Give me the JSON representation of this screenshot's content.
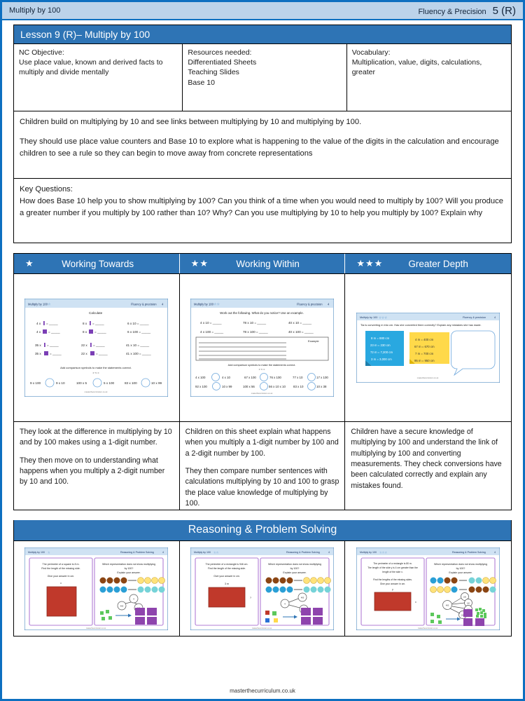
{
  "header": {
    "left_title": "Multiply by 100",
    "right_label": "Fluency & Precision",
    "page_number": "5 (R)"
  },
  "lesson": {
    "title": "Lesson 9 (R)– Multiply by 100",
    "nc_objective_label": "NC Objective:",
    "nc_objective_text": "Use place value, known and derived facts to multiply and divide mentally",
    "resources_label": "Resources needed:",
    "resources_items": [
      "Differentiated Sheets",
      "Teaching Slides",
      "Base 10"
    ],
    "vocabulary_label": "Vocabulary:",
    "vocabulary_text": "Multiplication, value, digits, calculations, greater"
  },
  "overview": {
    "para1": "Children build on multiplying by 10 and see links between multiplying by 10 and multiplying by 100.",
    "para2": "They should use place value counters and Base 10 to explore what is happening to the value of the digits in   the calculation and encourage children to see a rule so they can begin to move away from concrete representations"
  },
  "key_questions": {
    "label": "Key Questions:",
    "text": "How does Base 10 help you to show multiplying by 100? Can you think of a time when you would need to  multiply by 100? Will you produce a greater number if you multiply by 100 rather than 10? Why? Can you  use multiplying by 10 to help you multiply by 100? Explain why"
  },
  "differentiation": {
    "columns": [
      {
        "stars": "★",
        "label": "Working Towards",
        "description_1": "They look at the difference in multiplying by 10 and by 100 makes using a 1-digit number.",
        "description_2": "They then move on to understanding what happens when you  multiply a 2-digit number by 10 and 100."
      },
      {
        "stars": "★★",
        "label": "Working Within",
        "description_1": "Children on this sheet explain what happens when you multiply a 1-digit number by 100 and a 2-digit number by 100.",
        "description_2": "They then compare number sentences with calculations multiplying by 10 and 100 to grasp the place value knowledge of multiplying by 100."
      },
      {
        "stars": "★★★",
        "label": "Greater Depth",
        "description_1": "Children have a secure knowledge of multiplying by 100 and understand the link of multiplying by 100 and converting measurements. They check conversions have been calculated correctly and explain any mistakes found.",
        "description_2": ""
      }
    ]
  },
  "worksheet_previews": {
    "sheet1": {
      "header_left": "Multiply by 100",
      "header_right": "Fluency & precision",
      "page": "4",
      "title": "Calculate",
      "rows": [
        [
          "4 x | = _____",
          "8 x | = _____",
          "6 x 10 = _____"
        ],
        [
          "4 x ■ = _____",
          "8 x ■ = _____",
          "6 x 100 = _____"
        ],
        [
          "35 x | = _____",
          "22 x | = _____",
          "41 x 10 = _____"
        ],
        [
          "35 x ■ = _____",
          "22 x ■ = _____",
          "41 x 100 = _____"
        ]
      ],
      "instruction": "Add comparison symbols to make the statements correct.",
      "symbols": "> < =",
      "comparisons": [
        [
          "9 x 100",
          "9 x 10"
        ],
        [
          "100 x 5",
          "5 x 100"
        ],
        [
          "83 x 100",
          "10 x 99"
        ]
      ],
      "footer": "masterthecurriculum.co.uk"
    },
    "sheet2": {
      "header_left": "Multiply by 100",
      "header_right": "Fluency & precision",
      "page": "4",
      "title": "Work out the following. What do you notice? Use an example.",
      "rows": [
        [
          "4 x 10 = _____",
          "78 x 10 = _____",
          "40 x 10 = _____"
        ],
        [
          "4 x 100 = _____",
          "78 x 100 = _____",
          "40 x 100 = _____"
        ]
      ],
      "example_label": "Example",
      "instruction": "Add comparison symbols to make the statements correct.",
      "symbols": "> < =",
      "comparisons": [
        [
          "4 x 100",
          "4 x 10"
        ],
        [
          "67 x 100",
          "76 x 100"
        ],
        [
          "77 x 10",
          "17 x 100"
        ],
        [
          "92 x 100",
          "10 x 99"
        ],
        [
          "100 x 56",
          "56 x 10 x 10"
        ],
        [
          "83 x 10",
          "10 x 38"
        ]
      ],
      "footer": "masterthecurriculum.co.uk"
    },
    "sheet3": {
      "header_left": "Multiply by 100",
      "header_right": "Fluency & precision",
      "page": "4",
      "question": "Tia is converting m into cm. Has she converted them correctly? Explain any mistakes she has made.",
      "blue_note": [
        "8 m = 880 cm",
        "23 m = 230 cm",
        "72 m = 7,200 cm",
        "3 m = 3,000 cm"
      ],
      "yellow_note": [
        "4 m = 400 cm",
        "67 m = 670 cm",
        "7 m = 700 cm",
        "95 m = 950 cm"
      ],
      "footer": "masterthecurriculum.co.uk"
    }
  },
  "reasoning": {
    "bar_title": "Reasoning & Problem Solving",
    "slides": [
      {
        "header_left": "Multiply by 100",
        "header_right": "Reasoning & Problem Solving",
        "page": "4",
        "left_question": "The perimeter of a square is 8 m. Find the length of the missing side.",
        "left_prompt": "Give your answer in cm.",
        "shape_label": "x",
        "right_question": "Which representation does not show multiplying by 100?",
        "right_prompt": "Explain your answer.",
        "node_values": [
          "4",
          "400",
          "100"
        ]
      },
      {
        "header_left": "Multiply by 100",
        "header_right": "Reasoning & Problem Solving",
        "page": "4",
        "left_question": "The perimeter of a rectangle is 946 cm. Find the length of the missing side.",
        "left_prompt": "Give your answer in cm.",
        "shape_label": "3 m",
        "shape_unknown": "?",
        "right_question": "Which representation does not show multiplying by 100?",
        "right_prompt": "Explain your answer.",
        "node_values": [
          "4",
          "400",
          "100"
        ]
      },
      {
        "header_left": "Multiply by 100",
        "header_right": "Reasoning & Problem Solving",
        "page": "4",
        "left_question": "The perimeter of a rectangle is 80 m. The length of the side y is 4 cm greater than the length of the side x.",
        "left_prompt": "Find the lengths of the missing sides. Give your answer in cm.",
        "shape_label": "y",
        "shape_unknown": "x",
        "right_question": "Which representation does not show multiplying by 100?",
        "right_prompt": "Explain your answer.",
        "node_values": [
          "400",
          "100",
          "100",
          "100",
          "100"
        ]
      }
    ]
  },
  "footer": {
    "url": "masterthecurriculum.co.uk"
  },
  "colors": {
    "brand_blue": "#0d6fc0",
    "header_blue": "#bcd3ea",
    "title_blue": "#2e74b5",
    "purple": "#7b3fb5",
    "red_shape": "#c0392b"
  }
}
